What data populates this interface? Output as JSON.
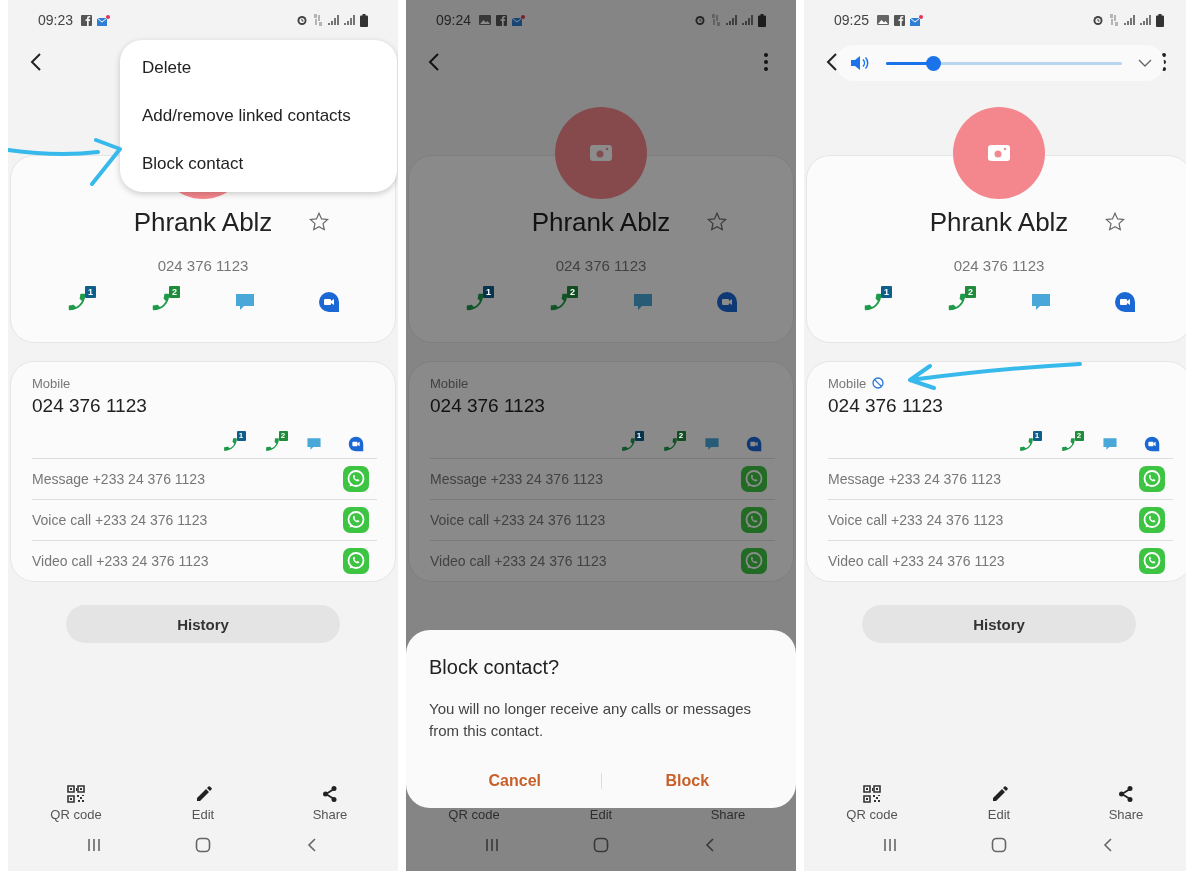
{
  "screens": [
    {
      "time": "09:23",
      "picture_notification": false,
      "more_button": false,
      "dimmed": false,
      "contact": {
        "name": "Phrank Ablz",
        "number": "024 376 1123",
        "favorite": false,
        "actions": [
          {
            "kind": "call",
            "badge": "1",
            "color": "#0d5f8c"
          },
          {
            "kind": "call",
            "badge": "2",
            "color": "#1f8b3b"
          },
          {
            "kind": "message"
          },
          {
            "kind": "video"
          }
        ]
      },
      "mobile": {
        "label": "Mobile",
        "number": "024 376 1123",
        "blocked": false,
        "actions": [
          {
            "kind": "call",
            "badge": "1",
            "color": "#0d5f8c"
          },
          {
            "kind": "call",
            "badge": "2",
            "color": "#1f8b3b"
          },
          {
            "kind": "message"
          },
          {
            "kind": "video"
          }
        ]
      },
      "whatsapp_rows": [
        "Message +233 24 376 1123",
        "Voice call +233 24 376 1123",
        "Video call +233 24 376 1123"
      ],
      "history": "History",
      "bottom_actions": [
        {
          "kind": "qr",
          "label": "QR code"
        },
        {
          "kind": "edit",
          "label": "Edit"
        },
        {
          "kind": "share",
          "label": "Share"
        }
      ],
      "overlay": {
        "kind": "menu",
        "items": [
          "Delete",
          "Add/remove linked contacts",
          "Block contact"
        ]
      },
      "annotation": {
        "kind": "arrow-right"
      }
    },
    {
      "time": "09:24",
      "picture_notification": true,
      "more_button": true,
      "dimmed": true,
      "contact": {
        "name": "Phrank Ablz",
        "number": "024 376 1123",
        "favorite": false,
        "actions": [
          {
            "kind": "call",
            "badge": "1",
            "color": "#07344d"
          },
          {
            "kind": "call",
            "badge": "2",
            "color": "#114d21"
          },
          {
            "kind": "message"
          },
          {
            "kind": "video"
          }
        ]
      },
      "mobile": {
        "label": "Mobile",
        "number": "024 376 1123",
        "blocked": false,
        "actions": [
          {
            "kind": "call",
            "badge": "1",
            "color": "#07344d"
          },
          {
            "kind": "call",
            "badge": "2",
            "color": "#114d21"
          },
          {
            "kind": "message"
          },
          {
            "kind": "video"
          }
        ]
      },
      "whatsapp_rows": [
        "Message +233 24 376 1123",
        "Voice call +233 24 376 1123",
        "Video call +233 24 376 1123"
      ],
      "bottom_actions": [
        {
          "label": "QR code"
        },
        {
          "label": "Edit"
        },
        {
          "label": "Share"
        }
      ],
      "overlay": {
        "kind": "dialog",
        "title": "Block contact?",
        "message": "You will no longer receive any calls or messages from this contact.",
        "buttons": [
          "Cancel",
          "Block"
        ]
      }
    },
    {
      "time": "09:25",
      "picture_notification": true,
      "more_button": true,
      "dimmed": false,
      "contact": {
        "name": "Phrank Ablz",
        "number": "024 376 1123",
        "favorite": false,
        "actions": [
          {
            "kind": "call",
            "badge": "1",
            "color": "#0d5f8c"
          },
          {
            "kind": "call",
            "badge": "2",
            "color": "#1f8b3b"
          },
          {
            "kind": "message"
          },
          {
            "kind": "video"
          }
        ]
      },
      "mobile": {
        "label": "Mobile",
        "number": "024 376 1123",
        "blocked": true,
        "actions": [
          {
            "kind": "call",
            "badge": "1",
            "color": "#0d5f8c"
          },
          {
            "kind": "call",
            "badge": "2",
            "color": "#1f8b3b"
          },
          {
            "kind": "message"
          },
          {
            "kind": "video"
          }
        ]
      },
      "whatsapp_rows": [
        "Message +233 24 376 1123",
        "Voice call +233 24 376 1123",
        "Video call +233 24 376 1123"
      ],
      "history": "History",
      "bottom_actions": [
        {
          "kind": "qr",
          "label": "QR code"
        },
        {
          "kind": "edit",
          "label": "Edit"
        },
        {
          "kind": "share",
          "label": "Share"
        }
      ],
      "overlay": {
        "kind": "volume",
        "level": 0.2
      },
      "annotation": {
        "kind": "arrow-left"
      }
    }
  ]
}
